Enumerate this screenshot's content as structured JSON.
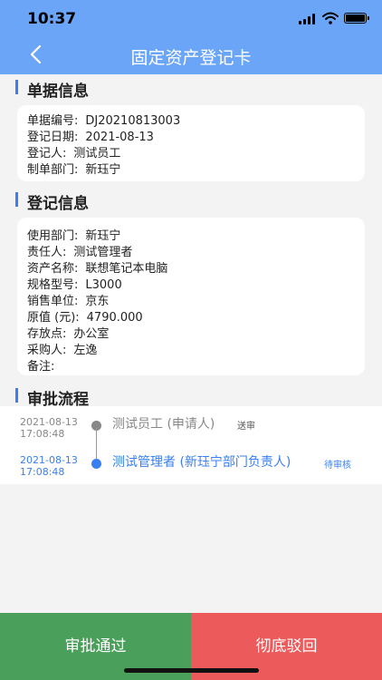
{
  "status_bar": {
    "time": "10:37"
  },
  "header": {
    "title": "固定资产登记卡"
  },
  "doc_info": {
    "title": "单据信息",
    "rows": [
      {
        "label": "单据编号:",
        "value": "DJ20210813003"
      },
      {
        "label": "登记日期:",
        "value": "2021-08-13"
      },
      {
        "label": "登记人:",
        "value": "测试员工"
      },
      {
        "label": "制单部门:",
        "value": "新珏宁"
      }
    ]
  },
  "reg_info": {
    "title": "登记信息",
    "rows": [
      {
        "label": "使用部门:",
        "value": "新珏宁"
      },
      {
        "label": "责任人:",
        "value": "测试管理者"
      },
      {
        "label": "资产名称:",
        "value": "联想笔记本电脑"
      },
      {
        "label": "规格型号:",
        "value": "L3000"
      },
      {
        "label": "销售单位:",
        "value": "京东"
      },
      {
        "label": "原值 (元):",
        "value": "4790.000"
      },
      {
        "label": "存放点:",
        "value": "办公室"
      },
      {
        "label": "采购人:",
        "value": "左逸"
      },
      {
        "label": "备注:",
        "value": ""
      }
    ]
  },
  "approval": {
    "title": "审批流程",
    "steps": [
      {
        "date": "2021-08-13",
        "time": "17:08:48",
        "name": "测试员工 (申请人)",
        "status": "送审"
      },
      {
        "date": "2021-08-13",
        "time": "17:08:48",
        "name": "测试管理者 (新珏宁部门负责人)",
        "status": "待审核"
      }
    ]
  },
  "actions": {
    "approve": "审批通过",
    "reject": "彻底驳回"
  },
  "colors": {
    "header": "#6aa5f8",
    "accent": "#3a7ff1",
    "approve": "#4aa05a",
    "reject": "#ec5a5c"
  }
}
